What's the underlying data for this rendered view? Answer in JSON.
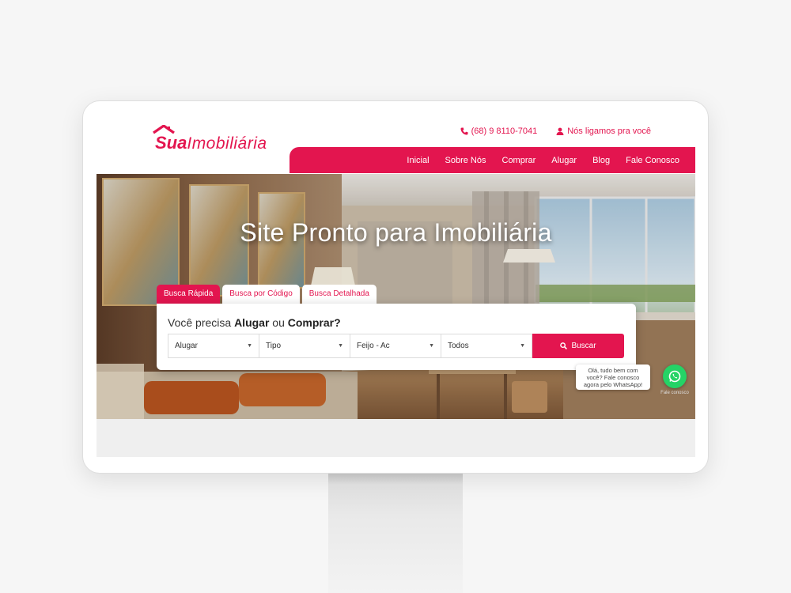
{
  "brand": {
    "logo_part1": "Sua",
    "logo_part2": "Imobiliária",
    "primary_color": "#e3154f"
  },
  "topbar": {
    "phone": "(68) 9 8110-7041",
    "callback": "Nós ligamos pra você",
    "phone_icon": "phone-icon",
    "callback_icon": "user-icon"
  },
  "nav": {
    "items": [
      "Inicial",
      "Sobre Nós",
      "Comprar",
      "Alugar",
      "Blog",
      "Fale Conosco"
    ]
  },
  "hero": {
    "title": "Site Pronto para Imobiliária"
  },
  "search": {
    "tabs": [
      "Busca Rápida",
      "Busca por Código",
      "Busca Detalhada"
    ],
    "active_tab": "Busca Rápida",
    "question_prefix": "Você precisa ",
    "question_opt1": "Alugar",
    "question_mid": " ou ",
    "question_opt2": "Comprar?",
    "fields": [
      "Alugar",
      "Tipo",
      "Feijo - Ac",
      "Todos"
    ],
    "button_label": "Buscar",
    "button_icon": "search-icon"
  },
  "whatsapp": {
    "bubble_text": "Olá, tudo bem com você? Fale conosco agora pelo WhatsApp!",
    "label": "Fale conosco",
    "icon": "whatsapp-icon"
  }
}
